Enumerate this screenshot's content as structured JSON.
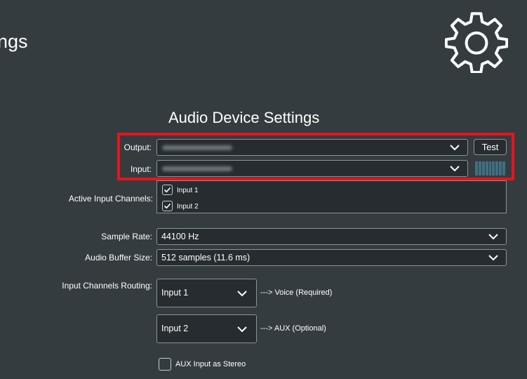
{
  "header": {
    "title": "ngs",
    "icon": "gear-icon"
  },
  "audio": {
    "title": "Audio Device Settings",
    "output_label": "Output:",
    "input_label": "Input:",
    "test_label": "Test",
    "active_channels_label": "Active Input Channels:",
    "channels": [
      {
        "label": "Input 1",
        "checked": true
      },
      {
        "label": "Input 2",
        "checked": true
      }
    ],
    "sample_rate_label": "Sample Rate:",
    "sample_rate_value": "44100 Hz",
    "buffer_label": "Audio Buffer Size:",
    "buffer_value": "512 samples (11.6 ms)",
    "routing_label": "Input Channels Routing:",
    "routes": [
      {
        "value": "Input 1",
        "dest": "---> Voice (Required)"
      },
      {
        "value": "Input 2",
        "dest": "---> AUX (Optional)"
      }
    ],
    "aux_stereo_label": "AUX Input as Stereo",
    "aux_stereo_checked": false
  },
  "colors": {
    "background": "#353c40",
    "highlight": "#e6151b",
    "meter": "#3f6f82"
  }
}
